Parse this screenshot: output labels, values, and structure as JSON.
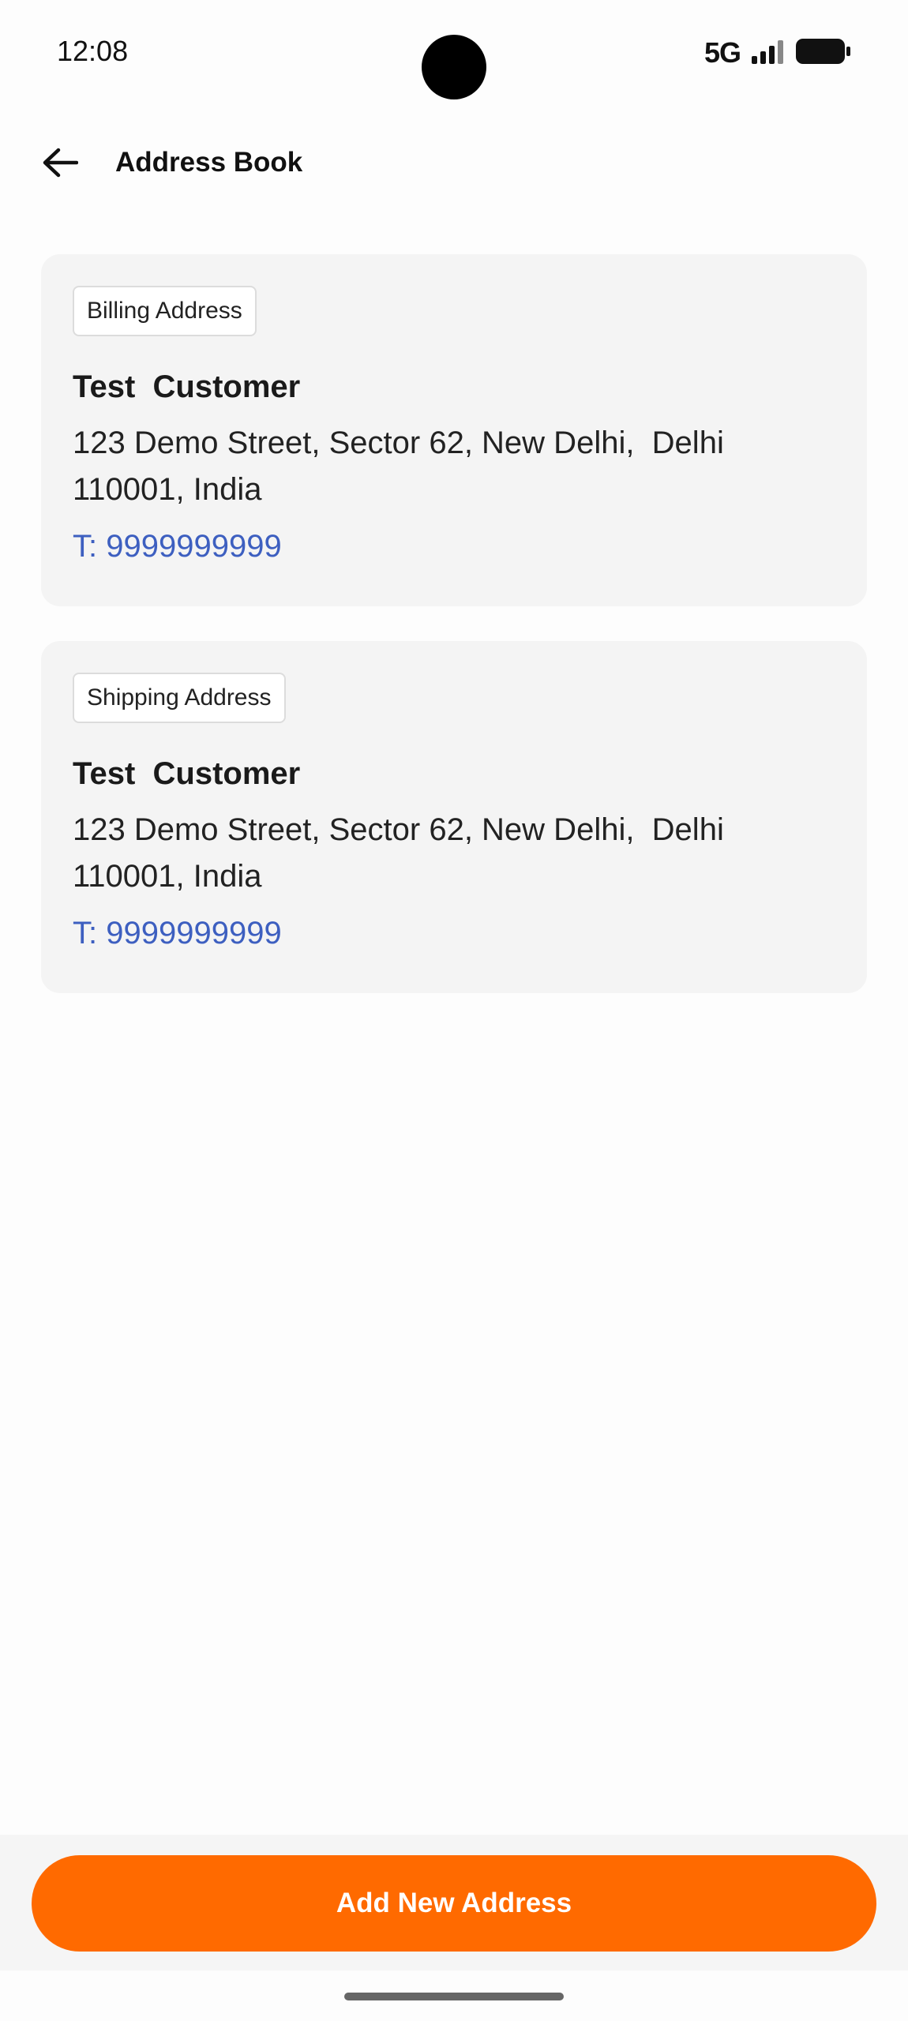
{
  "status_bar": {
    "time": "12:08",
    "network": "5G",
    "icons": [
      "signal-icon",
      "battery-icon"
    ]
  },
  "header": {
    "back_icon": "arrow-left-icon",
    "title": "Address Book"
  },
  "addresses": [
    {
      "type_label": "Billing Address",
      "name": "Test  Customer",
      "address": "123 Demo Street, Sector 62, New Delhi,  Delhi 110001, India",
      "phone": "T: 9999999999"
    },
    {
      "type_label": "Shipping Address",
      "name": "Test  Customer",
      "address": "123 Demo Street, Sector 62, New Delhi,  Delhi 110001, India",
      "phone": "T: 9999999999"
    }
  ],
  "footer": {
    "add_button_label": "Add New Address"
  },
  "colors": {
    "accent": "#ff6a00",
    "phone_link": "#3d5fc0",
    "card_background": "#f4f4f4"
  }
}
